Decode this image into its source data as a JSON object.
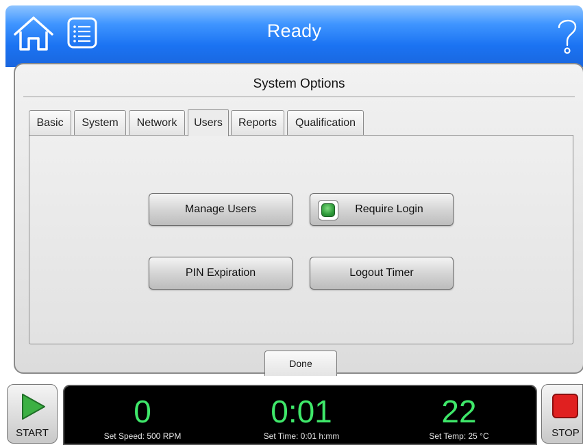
{
  "header": {
    "title": "Ready",
    "home_icon": "home-icon",
    "menu_icon": "list-menu-icon",
    "help_icon": "help-icon"
  },
  "dialog": {
    "title": "System Options",
    "tabs": [
      {
        "label": "Basic"
      },
      {
        "label": "System"
      },
      {
        "label": "Network"
      },
      {
        "label": "Users",
        "active": true
      },
      {
        "label": "Reports"
      },
      {
        "label": "Qualification"
      }
    ],
    "buttons": {
      "manage_users": "Manage Users",
      "require_login": "Require Login",
      "pin_expiration": "PIN Expiration",
      "logout_timer": "Logout Timer"
    },
    "require_login_enabled": true,
    "done_label": "Done"
  },
  "status_bar": {
    "start_label": "START",
    "stop_label": "STOP",
    "speed_value": "0",
    "speed_caption": "Set Speed: 500 RPM",
    "time_value": "0:01",
    "time_caption": "Set Time: 0:01 h:mm",
    "temp_value": "22",
    "temp_caption": "Set Temp: 25 °C"
  },
  "colors": {
    "header_blue": "#1b73f2",
    "readout_green": "#3fe86a",
    "led_green": "#2e9a3a",
    "stop_red": "#e02020",
    "start_green": "#3cb043"
  }
}
